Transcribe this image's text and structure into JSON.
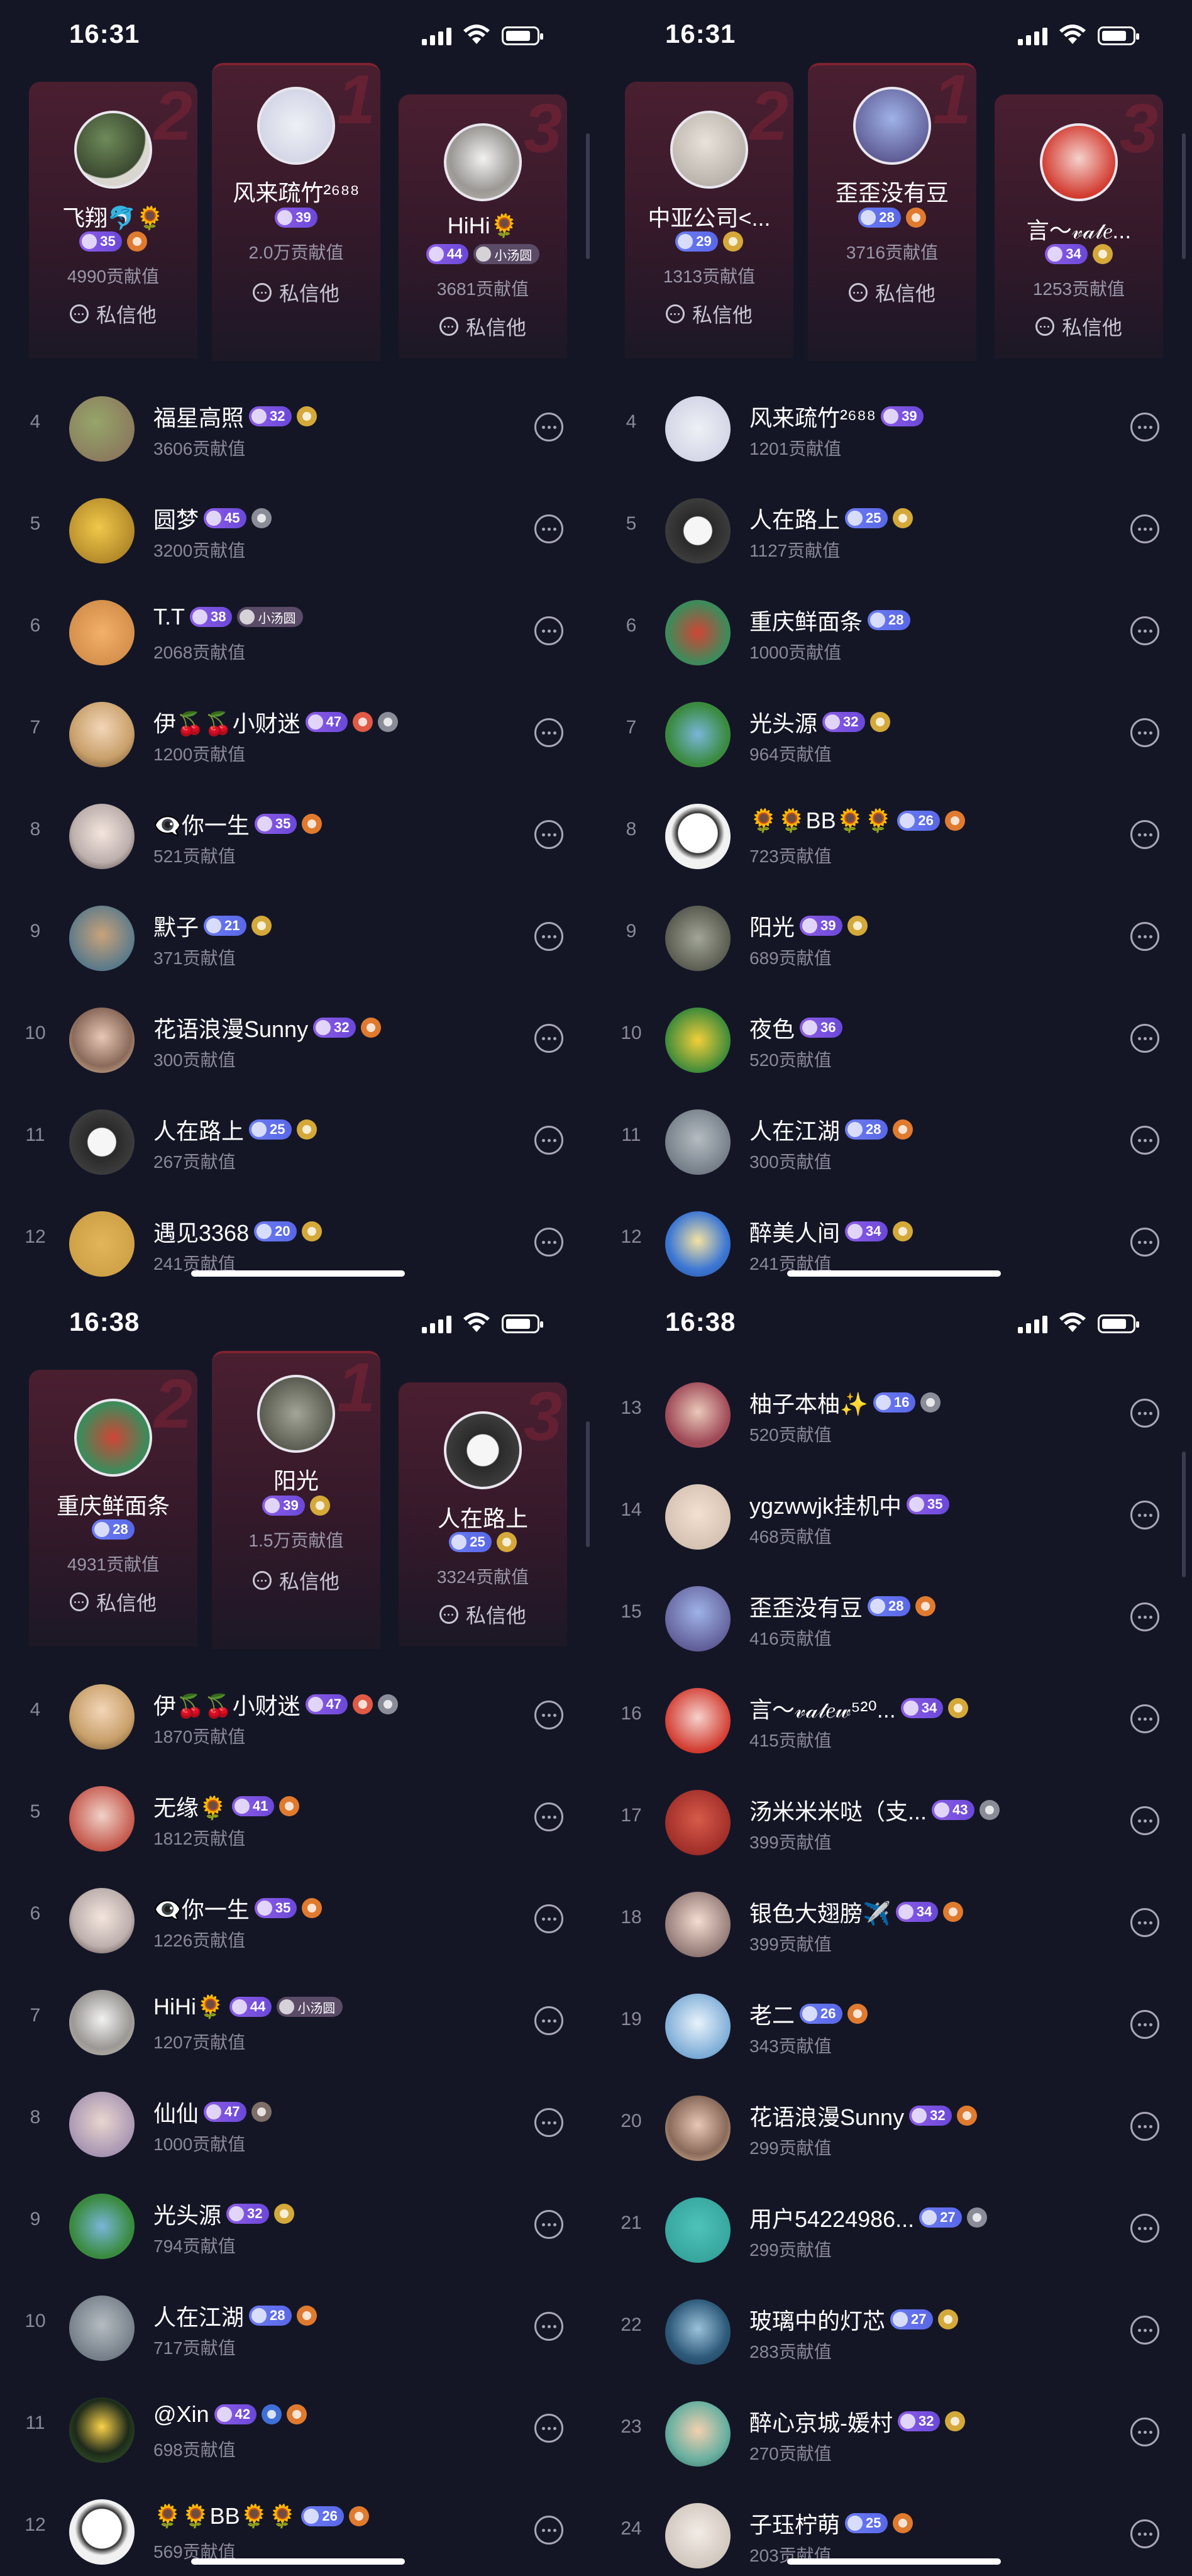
{
  "labels": {
    "value_suffix": "贡献值",
    "message": "私信他"
  },
  "panels": [
    {
      "time": "16:31",
      "podium": [
        {
          "rank": "2",
          "name": "飞翔🐬🌻",
          "badges": [
            {
              "t": "b-purple",
              "v": "35"
            },
            {
              "t": "b-orange",
              "v": ""
            }
          ],
          "value": "4990贡献值",
          "av": "a1"
        },
        {
          "rank": "1",
          "name": "风来疏竹²⁶⁸⁸",
          "badges": [
            {
              "t": "b-purple",
              "v": "39"
            }
          ],
          "value": "2.0万贡献值",
          "av": "a2"
        },
        {
          "rank": "3",
          "name": "HiHi🌻",
          "badges": [
            {
              "t": "b-purple",
              "v": "44"
            },
            {
              "t": "b-tag",
              "v": "小汤圆"
            }
          ],
          "value": "3681贡献值",
          "av": "a3"
        }
      ],
      "rows": [
        {
          "n": "4",
          "name": "福星高照",
          "badges": [
            {
              "t": "b-purple",
              "v": "32"
            },
            {
              "t": "b-gold",
              "v": ""
            }
          ],
          "value": "3606贡献值",
          "av": "a7"
        },
        {
          "n": "5",
          "name": "圆梦",
          "badges": [
            {
              "t": "b-purple",
              "v": "45"
            },
            {
              "t": "b-silver",
              "v": ""
            }
          ],
          "value": "3200贡献值",
          "av": "a8"
        },
        {
          "n": "6",
          "name": "T.T",
          "badges": [
            {
              "t": "b-purple",
              "v": "38"
            },
            {
              "t": "b-tag",
              "v": "小汤圆"
            }
          ],
          "value": "2068贡献值",
          "av": "a9"
        },
        {
          "n": "7",
          "name": "伊🍒🍒小财迷",
          "badges": [
            {
              "t": "b-purple",
              "v": "47"
            },
            {
              "t": "b-red",
              "v": ""
            },
            {
              "t": "b-silver",
              "v": ""
            }
          ],
          "value": "1200贡献值",
          "av": "a10"
        },
        {
          "n": "8",
          "name": "👁‍🗨你一生",
          "badges": [
            {
              "t": "b-purple",
              "v": "35"
            },
            {
              "t": "b-orange",
              "v": ""
            }
          ],
          "value": "521贡献值",
          "av": "a11"
        },
        {
          "n": "9",
          "name": "默子",
          "badges": [
            {
              "t": "b-blue",
              "v": "21"
            },
            {
              "t": "b-gold",
              "v": ""
            }
          ],
          "value": "371贡献值",
          "av": "a12"
        },
        {
          "n": "10",
          "name": "花语浪漫Sunny",
          "badges": [
            {
              "t": "b-purple",
              "v": "32"
            },
            {
              "t": "b-orange",
              "v": ""
            }
          ],
          "value": "300贡献值",
          "av": "a13"
        },
        {
          "n": "11",
          "name": "人在路上",
          "badges": [
            {
              "t": "b-blue",
              "v": "25"
            },
            {
              "t": "b-gold",
              "v": ""
            }
          ],
          "value": "267贡献值",
          "av": "a14"
        },
        {
          "n": "12",
          "name": "遇见3368",
          "badges": [
            {
              "t": "b-blue",
              "v": "20"
            },
            {
              "t": "b-gold",
              "v": ""
            }
          ],
          "value": "241贡献值",
          "av": "a15"
        }
      ]
    },
    {
      "time": "16:31",
      "podium": [
        {
          "rank": "2",
          "name": "中亚公司<...",
          "badges": [
            {
              "t": "b-blue",
              "v": "29"
            },
            {
              "t": "b-gold",
              "v": ""
            }
          ],
          "value": "1313贡献值",
          "av": "a4"
        },
        {
          "rank": "1",
          "name": "歪歪没有豆",
          "badges": [
            {
              "t": "b-blue",
              "v": "28"
            },
            {
              "t": "b-orange",
              "v": ""
            }
          ],
          "value": "3716贡献值",
          "av": "a5"
        },
        {
          "rank": "3",
          "name": "言～𝓋𝒶𝓉𝑒...",
          "badges": [
            {
              "t": "b-purple",
              "v": "34"
            },
            {
              "t": "b-gold",
              "v": ""
            }
          ],
          "value": "1253贡献值",
          "av": "a6"
        }
      ],
      "rows": [
        {
          "n": "4",
          "name": "风来疏竹²⁶⁸⁸",
          "badges": [
            {
              "t": "b-purple",
              "v": "39"
            }
          ],
          "value": "1201贡献值",
          "av": "a2"
        },
        {
          "n": "5",
          "name": "人在路上",
          "badges": [
            {
              "t": "b-blue",
              "v": "25"
            },
            {
              "t": "b-gold",
              "v": ""
            }
          ],
          "value": "1127贡献值",
          "av": "a14"
        },
        {
          "n": "6",
          "name": "重庆鲜面条",
          "badges": [
            {
              "t": "b-blue",
              "v": "28"
            }
          ],
          "value": "1000贡献值",
          "av": "a17"
        },
        {
          "n": "7",
          "name": "光头源",
          "badges": [
            {
              "t": "b-purple",
              "v": "32"
            },
            {
              "t": "b-gold",
              "v": ""
            }
          ],
          "value": "964贡献值",
          "av": "a18"
        },
        {
          "n": "8",
          "name": "🌻🌻BB🌻🌻",
          "badges": [
            {
              "t": "b-blue",
              "v": "26"
            },
            {
              "t": "b-orange",
              "v": ""
            }
          ],
          "value": "723贡献值",
          "av": "a19"
        },
        {
          "n": "9",
          "name": "阳光",
          "badges": [
            {
              "t": "b-purple",
              "v": "39"
            },
            {
              "t": "b-gold",
              "v": ""
            }
          ],
          "value": "689贡献值",
          "av": "a20"
        },
        {
          "n": "10",
          "name": "夜色",
          "badges": [
            {
              "t": "b-purple",
              "v": "36"
            }
          ],
          "value": "520贡献值",
          "av": "a21"
        },
        {
          "n": "11",
          "name": "人在江湖",
          "badges": [
            {
              "t": "b-blue",
              "v": "28"
            },
            {
              "t": "b-orange",
              "v": ""
            }
          ],
          "value": "300贡献值",
          "av": "a22"
        },
        {
          "n": "12",
          "name": "醉美人间",
          "badges": [
            {
              "t": "b-purple",
              "v": "34"
            },
            {
              "t": "b-gold",
              "v": ""
            }
          ],
          "value": "241贡献值",
          "av": "a23"
        }
      ]
    },
    {
      "time": "16:38",
      "podium": [
        {
          "rank": "2",
          "name": "重庆鲜面条",
          "badges": [
            {
              "t": "b-blue",
              "v": "28"
            }
          ],
          "value": "4931贡献值",
          "av": "a17"
        },
        {
          "rank": "1",
          "name": "阳光",
          "badges": [
            {
              "t": "b-purple",
              "v": "39"
            },
            {
              "t": "b-gold",
              "v": ""
            }
          ],
          "value": "1.5万贡献值",
          "av": "a20"
        },
        {
          "rank": "3",
          "name": "人在路上",
          "badges": [
            {
              "t": "b-blue",
              "v": "25"
            },
            {
              "t": "b-gold",
              "v": ""
            }
          ],
          "value": "3324贡献值",
          "av": "a14"
        }
      ],
      "rows": [
        {
          "n": "4",
          "name": "伊🍒🍒小财迷",
          "badges": [
            {
              "t": "b-purple",
              "v": "47"
            },
            {
              "t": "b-red",
              "v": ""
            },
            {
              "t": "b-silver",
              "v": ""
            }
          ],
          "value": "1870贡献值",
          "av": "a10"
        },
        {
          "n": "5",
          "name": "无缘🌻",
          "badges": [
            {
              "t": "b-purple",
              "v": "41"
            },
            {
              "t": "b-orange",
              "v": ""
            }
          ],
          "value": "1812贡献值",
          "av": "a24"
        },
        {
          "n": "6",
          "name": "👁‍🗨你一生",
          "badges": [
            {
              "t": "b-purple",
              "v": "35"
            },
            {
              "t": "b-orange",
              "v": ""
            }
          ],
          "value": "1226贡献值",
          "av": "a11"
        },
        {
          "n": "7",
          "name": "HiHi🌻",
          "badges": [
            {
              "t": "b-purple",
              "v": "44"
            },
            {
              "t": "b-tag",
              "v": "小汤圆"
            }
          ],
          "value": "1207贡献值",
          "av": "a3"
        },
        {
          "n": "8",
          "name": "仙仙",
          "badges": [
            {
              "t": "b-purple",
              "v": "47"
            },
            {
              "t": "b-grey2",
              "v": ""
            }
          ],
          "value": "1000贡献值",
          "av": "a25"
        },
        {
          "n": "9",
          "name": "光头源",
          "badges": [
            {
              "t": "b-purple",
              "v": "32"
            },
            {
              "t": "b-gold",
              "v": ""
            }
          ],
          "value": "794贡献值",
          "av": "a18"
        },
        {
          "n": "10",
          "name": "人在江湖",
          "badges": [
            {
              "t": "b-blue",
              "v": "28"
            },
            {
              "t": "b-orange",
              "v": ""
            }
          ],
          "value": "717贡献值",
          "av": "a22"
        },
        {
          "n": "11",
          "name": "@Xin",
          "badges": [
            {
              "t": "b-purple",
              "v": "42"
            },
            {
              "t": "b-blue2",
              "v": ""
            },
            {
              "t": "b-orange",
              "v": ""
            }
          ],
          "value": "698贡献值",
          "av": "a37"
        },
        {
          "n": "12",
          "name": "🌻🌻BB🌻🌻",
          "badges": [
            {
              "t": "b-blue",
              "v": "26"
            },
            {
              "t": "b-orange",
              "v": ""
            }
          ],
          "value": "569贡献值",
          "av": "a19"
        }
      ]
    },
    {
      "time": "16:38",
      "podium": [],
      "rows": [
        {
          "n": "13",
          "name": "柚子本柚✨",
          "badges": [
            {
              "t": "b-blue",
              "v": "16"
            },
            {
              "t": "b-silver",
              "v": ""
            }
          ],
          "value": "520贡献值",
          "av": "a39"
        },
        {
          "n": "14",
          "name": "ygzwwjk挂机中",
          "badges": [
            {
              "t": "b-purple",
              "v": "35"
            }
          ],
          "value": "468贡献值",
          "av": "a40"
        },
        {
          "n": "15",
          "name": "歪歪没有豆",
          "badges": [
            {
              "t": "b-blue",
              "v": "28"
            },
            {
              "t": "b-orange",
              "v": ""
            }
          ],
          "value": "416贡献值",
          "av": "a5"
        },
        {
          "n": "16",
          "name": "言～𝓋𝒶𝓉𝑒𝓌⁵²⁰...",
          "badges": [
            {
              "t": "b-purple",
              "v": "34"
            },
            {
              "t": "b-gold",
              "v": ""
            }
          ],
          "value": "415贡献值",
          "av": "a6"
        },
        {
          "n": "17",
          "name": "汤米米米哒（支...",
          "badges": [
            {
              "t": "b-purple",
              "v": "43"
            },
            {
              "t": "b-silver",
              "v": ""
            }
          ],
          "value": "399贡献值",
          "av": "a27"
        },
        {
          "n": "18",
          "name": "银色大翅膀✈️",
          "badges": [
            {
              "t": "b-purple",
              "v": "34"
            },
            {
              "t": "b-orange",
              "v": ""
            }
          ],
          "value": "399贡献值",
          "av": "a28"
        },
        {
          "n": "19",
          "name": "老二",
          "badges": [
            {
              "t": "b-blue",
              "v": "26"
            },
            {
              "t": "b-orange",
              "v": ""
            }
          ],
          "value": "343贡献值",
          "av": "a29"
        },
        {
          "n": "20",
          "name": "花语浪漫Sunny",
          "badges": [
            {
              "t": "b-purple",
              "v": "32"
            },
            {
              "t": "b-orange",
              "v": ""
            }
          ],
          "value": "299贡献值",
          "av": "a13"
        },
        {
          "n": "21",
          "name": "用户54224986...",
          "badges": [
            {
              "t": "b-blue",
              "v": "27"
            },
            {
              "t": "b-silver",
              "v": ""
            }
          ],
          "value": "299贡献值",
          "av": "a30"
        },
        {
          "n": "22",
          "name": "玻璃中的灯芯",
          "badges": [
            {
              "t": "b-blue",
              "v": "27"
            },
            {
              "t": "b-gold",
              "v": ""
            }
          ],
          "value": "283贡献值",
          "av": "a31"
        },
        {
          "n": "23",
          "name": "醉心京城-媛村",
          "badges": [
            {
              "t": "b-purple",
              "v": "32"
            },
            {
              "t": "b-gold",
              "v": ""
            }
          ],
          "value": "270贡献值",
          "av": "a32"
        },
        {
          "n": "24",
          "name": "子珏柠萌",
          "badges": [
            {
              "t": "b-blue",
              "v": "25"
            },
            {
              "t": "b-orange",
              "v": ""
            }
          ],
          "value": "203贡献值",
          "av": "a33"
        }
      ]
    }
  ]
}
